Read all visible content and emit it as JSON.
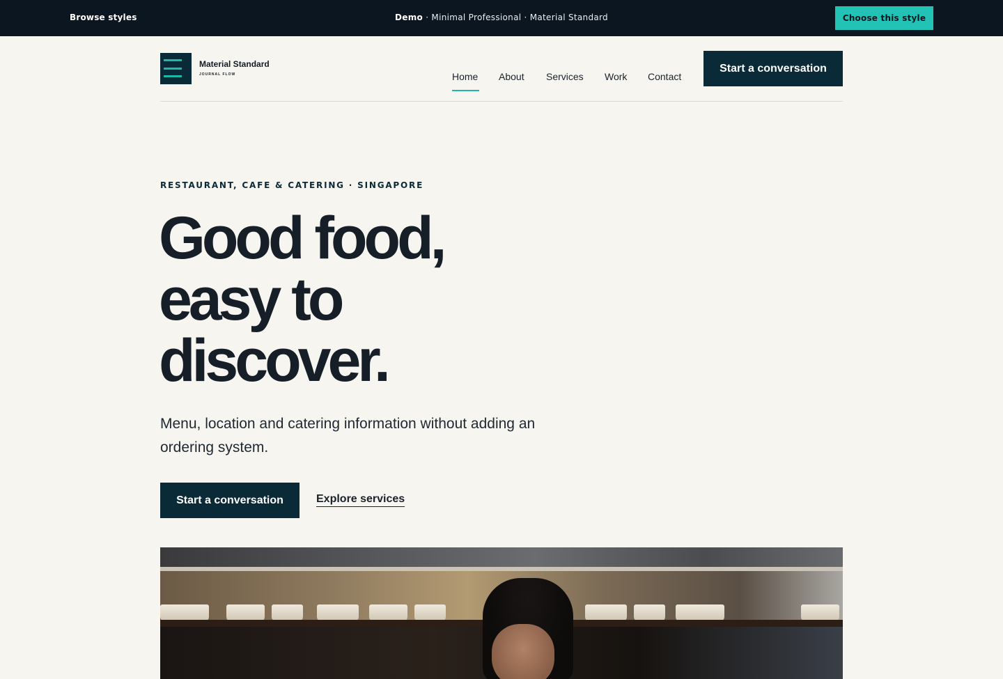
{
  "demo_bar": {
    "browse_label": "Browse styles",
    "demo_label": "Demo",
    "style_info": "· Minimal Professional · Material Standard",
    "choose_label": "Choose this style"
  },
  "header": {
    "logo_name": "Material Standard",
    "logo_tagline": "JOURNAL FLOW",
    "nav": [
      "Home",
      "About",
      "Services",
      "Work",
      "Contact"
    ],
    "active_nav": "Home",
    "cta_label": "Start a conversation"
  },
  "hero": {
    "eyebrow": "RESTAURANT, CAFE & CATERING · SINGAPORE",
    "title_lines": [
      "Good food,",
      "easy to",
      "discover."
    ],
    "subtitle": "Menu, location and catering information without adding an ordering system.",
    "primary_cta": "Start a conversation",
    "secondary_cta": "Explore services"
  },
  "colors": {
    "accent": "#1fb8a8",
    "brand_dark": "#0b2a38",
    "demo_bar_bg": "#0b1620",
    "page_bg": "#f6f5f0",
    "choose_button": "#22c3b5"
  }
}
